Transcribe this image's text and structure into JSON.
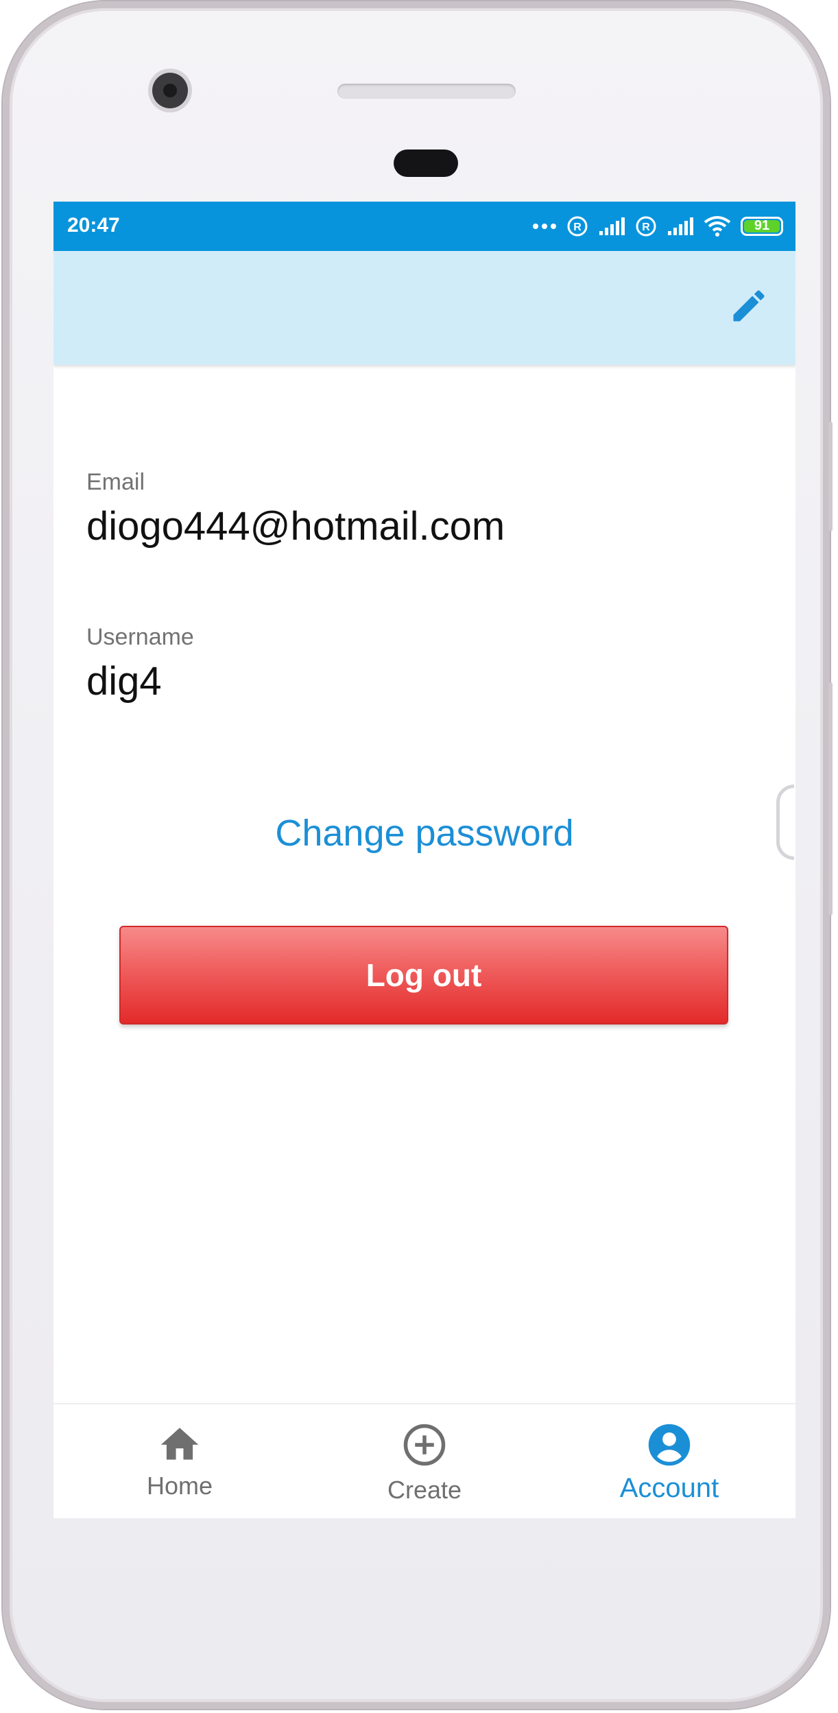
{
  "status_bar": {
    "time": "20:47",
    "battery_level": "91",
    "background_color": "#0894dc"
  },
  "app_bar": {
    "background_color": "#d1ecf9",
    "edit_icon": "pencil-icon"
  },
  "profile": {
    "email_label": "Email",
    "email_value": "diogo444@hotmail.com",
    "username_label": "Username",
    "username_value": "dig4"
  },
  "actions": {
    "change_password_label": "Change password",
    "logout_label": "Log out",
    "logout_color": "#e32a2a"
  },
  "bottom_nav": {
    "items": [
      {
        "label": "Home",
        "icon": "home-icon",
        "active": false
      },
      {
        "label": "Create",
        "icon": "add-circle-icon",
        "active": false
      },
      {
        "label": "Account",
        "icon": "account-circle-icon",
        "active": true
      }
    ],
    "active_color": "#1b8fd6",
    "inactive_color": "#6f6f6f"
  }
}
